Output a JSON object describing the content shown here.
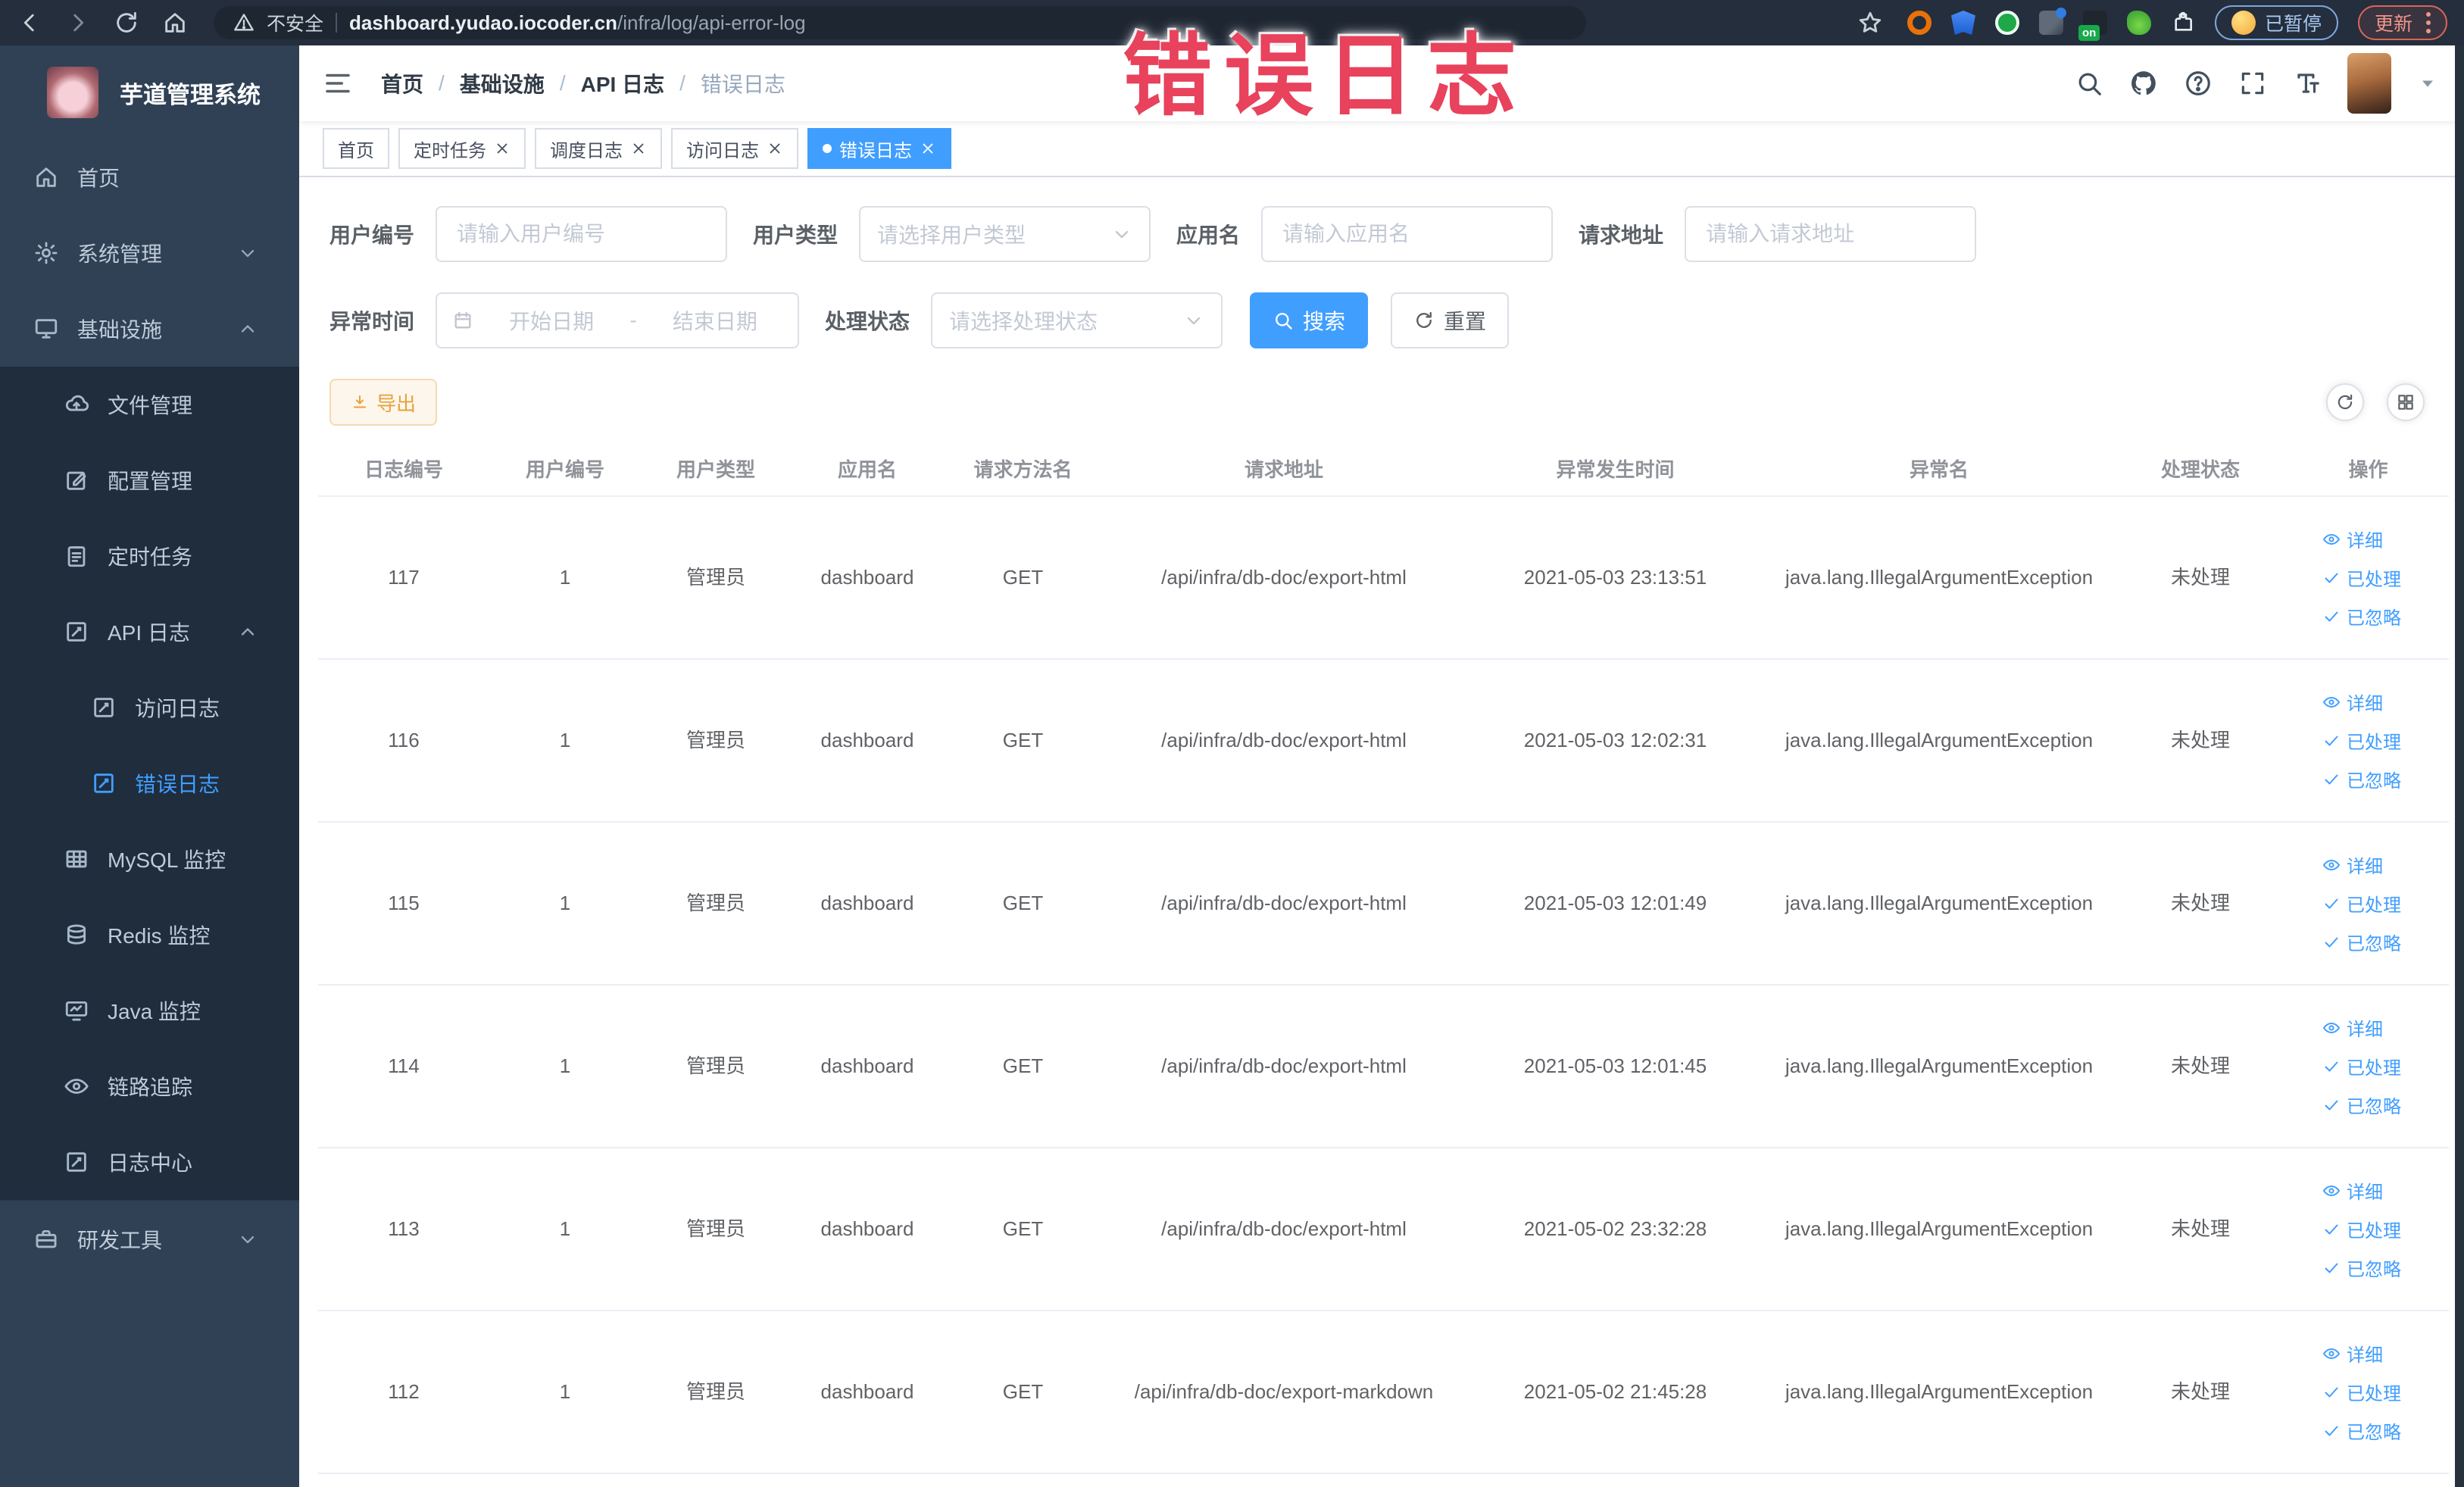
{
  "browser": {
    "security_label": "不安全",
    "url_domain": "dashboard.yudao.iocoder.cn",
    "url_path": "/infra/log/api-error-log",
    "ext_badge_label": "on",
    "paused_label": "已暂停",
    "update_label": "更新"
  },
  "overlay_title": "错误日志",
  "sidebar": {
    "app_title": "芋道管理系统",
    "items": [
      {
        "id": "home",
        "label": "首页",
        "icon": "home-icon",
        "level": 1
      },
      {
        "id": "system",
        "label": "系统管理",
        "icon": "gear-icon",
        "level": 1,
        "chevron": "down"
      },
      {
        "id": "infra",
        "label": "基础设施",
        "icon": "monitor-icon",
        "level": 1,
        "chevron": "up"
      },
      {
        "id": "file",
        "label": "文件管理",
        "icon": "cloud-upload-icon",
        "level": 2,
        "group": "sub"
      },
      {
        "id": "config",
        "label": "配置管理",
        "icon": "edit-icon",
        "level": 2,
        "group": "sub"
      },
      {
        "id": "job",
        "label": "定时任务",
        "icon": "clipboard-icon",
        "level": 2,
        "group": "sub"
      },
      {
        "id": "api-log",
        "label": "API 日志",
        "icon": "log-icon",
        "level": 2,
        "chevron": "up",
        "group": "sub"
      },
      {
        "id": "access-log",
        "label": "访问日志",
        "icon": "log-icon",
        "level": 3,
        "group": "sub"
      },
      {
        "id": "error-log",
        "label": "错误日志",
        "icon": "log-icon",
        "level": 3,
        "group": "sub",
        "active": true
      },
      {
        "id": "mysql",
        "label": "MySQL 监控",
        "icon": "table-icon",
        "level": 2,
        "group": "sub"
      },
      {
        "id": "redis",
        "label": "Redis 监控",
        "icon": "layers-icon",
        "level": 2,
        "group": "sub"
      },
      {
        "id": "java",
        "label": "Java 监控",
        "icon": "screen-icon",
        "level": 2,
        "group": "sub"
      },
      {
        "id": "trace",
        "label": "链路追踪",
        "icon": "eye-icon",
        "level": 2,
        "group": "sub"
      },
      {
        "id": "log-center",
        "label": "日志中心",
        "icon": "log-icon",
        "level": 2,
        "group": "sub"
      },
      {
        "id": "dev-tools",
        "label": "研发工具",
        "icon": "briefcase-icon",
        "level": 1,
        "chevron": "down",
        "divider_top": true
      }
    ]
  },
  "breadcrumb": {
    "separator": "/",
    "items": [
      "首页",
      "基础设施",
      "API 日志",
      "错误日志"
    ]
  },
  "tabs": {
    "items": [
      {
        "label": "首页",
        "closable": false,
        "active": false
      },
      {
        "label": "定时任务",
        "closable": true,
        "active": false
      },
      {
        "label": "调度日志",
        "closable": true,
        "active": false
      },
      {
        "label": "访问日志",
        "closable": true,
        "active": false
      },
      {
        "label": "错误日志",
        "closable": true,
        "active": true
      }
    ]
  },
  "filters": {
    "user_id": {
      "label": "用户编号",
      "placeholder": "请输入用户编号"
    },
    "user_type": {
      "label": "用户类型",
      "placeholder": "请选择用户类型"
    },
    "app_name": {
      "label": "应用名",
      "placeholder": "请输入应用名"
    },
    "request_url": {
      "label": "请求地址",
      "placeholder": "请输入请求地址"
    },
    "exception_time": {
      "label": "异常时间",
      "start_placeholder": "开始日期",
      "separator": "-",
      "end_placeholder": "结束日期"
    },
    "process_status": {
      "label": "处理状态",
      "placeholder": "请选择处理状态"
    },
    "search_label": "搜索",
    "reset_label": "重置"
  },
  "toolbar": {
    "export_label": "导出"
  },
  "table": {
    "headers": [
      "日志编号",
      "用户编号",
      "用户类型",
      "应用名",
      "请求方法名",
      "请求地址",
      "异常发生时间",
      "异常名",
      "处理状态",
      "操作"
    ],
    "action_labels": {
      "detail": "详细",
      "processed": "已处理",
      "ignored": "已忽略"
    },
    "rows": [
      {
        "id": "117",
        "user_id": "1",
        "user_type": "管理员",
        "app_name": "dashboard",
        "method": "GET",
        "url": "/api/infra/db-doc/export-html",
        "time": "2021-05-03 23:13:51",
        "exception": "java.lang.IllegalArgumentException",
        "status": "未处理"
      },
      {
        "id": "116",
        "user_id": "1",
        "user_type": "管理员",
        "app_name": "dashboard",
        "method": "GET",
        "url": "/api/infra/db-doc/export-html",
        "time": "2021-05-03 12:02:31",
        "exception": "java.lang.IllegalArgumentException",
        "status": "未处理"
      },
      {
        "id": "115",
        "user_id": "1",
        "user_type": "管理员",
        "app_name": "dashboard",
        "method": "GET",
        "url": "/api/infra/db-doc/export-html",
        "time": "2021-05-03 12:01:49",
        "exception": "java.lang.IllegalArgumentException",
        "status": "未处理"
      },
      {
        "id": "114",
        "user_id": "1",
        "user_type": "管理员",
        "app_name": "dashboard",
        "method": "GET",
        "url": "/api/infra/db-doc/export-html",
        "time": "2021-05-03 12:01:45",
        "exception": "java.lang.IllegalArgumentException",
        "status": "未处理"
      },
      {
        "id": "113",
        "user_id": "1",
        "user_type": "管理员",
        "app_name": "dashboard",
        "method": "GET",
        "url": "/api/infra/db-doc/export-html",
        "time": "2021-05-02 23:32:28",
        "exception": "java.lang.IllegalArgumentException",
        "status": "未处理"
      },
      {
        "id": "112",
        "user_id": "1",
        "user_type": "管理员",
        "app_name": "dashboard",
        "method": "GET",
        "url": "/api/infra/db-doc/export-markdown",
        "time": "2021-05-02 21:45:28",
        "exception": "java.lang.IllegalArgumentException",
        "status": "未处理"
      }
    ]
  },
  "colors": {
    "accent": "#409eff",
    "sidebar_bg": "#304156",
    "submenu_bg": "#1f2d3d",
    "warning_text": "#e6a23c",
    "overlay": "#e8425c",
    "tab_border": "#d8dce5"
  }
}
